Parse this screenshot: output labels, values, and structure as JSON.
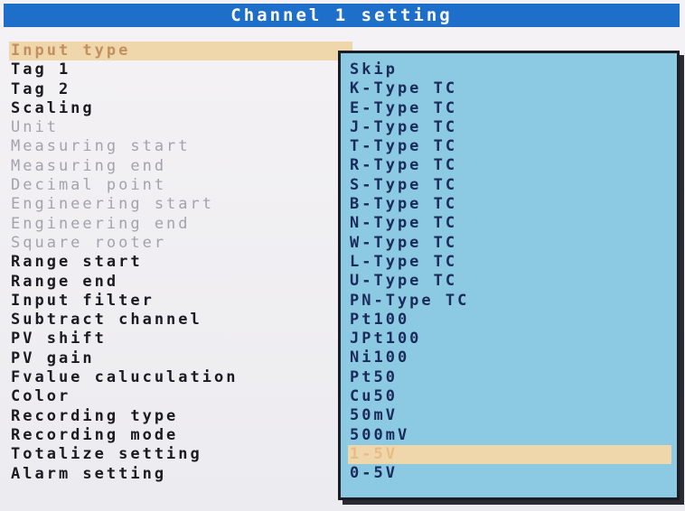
{
  "window": {
    "title": "Channel 1 setting"
  },
  "menu": {
    "items": [
      {
        "label": "Input type",
        "state": "selected"
      },
      {
        "label": "Tag 1",
        "state": "enabled"
      },
      {
        "label": "Tag 2",
        "state": "enabled"
      },
      {
        "label": "Scaling",
        "state": "enabled"
      },
      {
        "label": "Unit",
        "state": "disabled"
      },
      {
        "label": "Measuring start",
        "state": "disabled"
      },
      {
        "label": "Measuring end",
        "state": "disabled"
      },
      {
        "label": "Decimal point",
        "state": "disabled"
      },
      {
        "label": "Engineering start",
        "state": "disabled"
      },
      {
        "label": "Engineering end",
        "state": "disabled"
      },
      {
        "label": "Square rooter",
        "state": "disabled"
      },
      {
        "label": "Range start",
        "state": "enabled"
      },
      {
        "label": "Range end",
        "state": "enabled"
      },
      {
        "label": "Input filter",
        "state": "enabled"
      },
      {
        "label": "Subtract channel",
        "state": "enabled"
      },
      {
        "label": "PV shift",
        "state": "enabled"
      },
      {
        "label": "PV gain",
        "state": "enabled"
      },
      {
        "label": "Fvalue caluculation",
        "state": "enabled"
      },
      {
        "label": "Color",
        "state": "enabled"
      },
      {
        "label": "Recording type",
        "state": "enabled"
      },
      {
        "label": "Recording mode",
        "state": "enabled"
      },
      {
        "label": "Totalize setting",
        "state": "enabled"
      },
      {
        "label": "Alarm setting",
        "state": "enabled"
      }
    ]
  },
  "input_type_dropdown": {
    "options": [
      "Skip",
      "K-Type TC",
      "E-Type TC",
      "J-Type TC",
      "T-Type TC",
      "R-Type TC",
      "S-Type TC",
      "B-Type TC",
      "N-Type TC",
      "W-Type TC",
      "L-Type TC",
      "U-Type TC",
      "PN-Type TC",
      "Pt100",
      "JPt100",
      "Ni100",
      "Pt50",
      "Cu50",
      "50mV",
      "500mV",
      "1-5V",
      "0-5V"
    ],
    "selected_index": 20
  }
}
